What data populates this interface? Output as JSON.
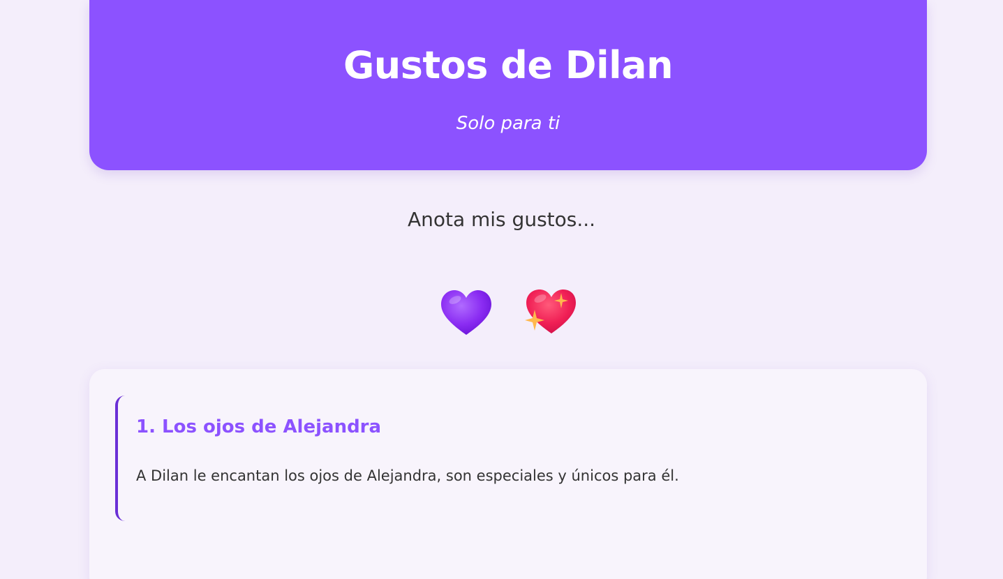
{
  "header": {
    "title": "Gustos de Dilan",
    "subtitle": "Solo para ti",
    "color": "#8c52ff"
  },
  "intro": {
    "text": "Anota mis gustos..."
  },
  "decorations": {
    "hearts": [
      "purple-heart-icon",
      "sparkling-heart-icon"
    ]
  },
  "likes": [
    {
      "title": "1. Los ojos de Alejandra",
      "description": "A Dilan le encantan los ojos de Alejandra, son especiales y únicos para él."
    }
  ],
  "colors": {
    "background": "#f4eefb",
    "accent": "#8c52ff",
    "border": "#6a2fd6",
    "text": "#333333"
  }
}
